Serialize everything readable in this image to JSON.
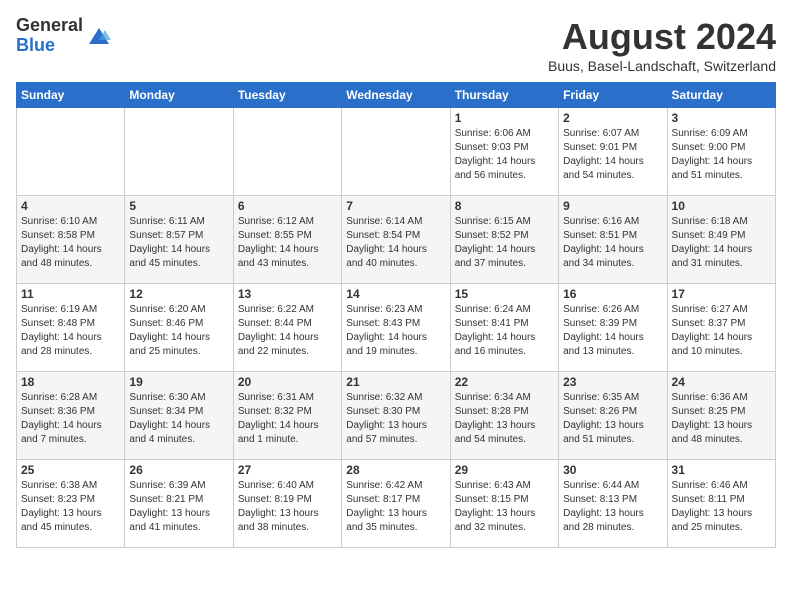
{
  "logo": {
    "general": "General",
    "blue": "Blue"
  },
  "header": {
    "month_year": "August 2024",
    "location": "Buus, Basel-Landschaft, Switzerland"
  },
  "weekdays": [
    "Sunday",
    "Monday",
    "Tuesday",
    "Wednesday",
    "Thursday",
    "Friday",
    "Saturday"
  ],
  "weeks": [
    [
      {
        "day": "",
        "info": ""
      },
      {
        "day": "",
        "info": ""
      },
      {
        "day": "",
        "info": ""
      },
      {
        "day": "",
        "info": ""
      },
      {
        "day": "1",
        "info": "Sunrise: 6:06 AM\nSunset: 9:03 PM\nDaylight: 14 hours\nand 56 minutes."
      },
      {
        "day": "2",
        "info": "Sunrise: 6:07 AM\nSunset: 9:01 PM\nDaylight: 14 hours\nand 54 minutes."
      },
      {
        "day": "3",
        "info": "Sunrise: 6:09 AM\nSunset: 9:00 PM\nDaylight: 14 hours\nand 51 minutes."
      }
    ],
    [
      {
        "day": "4",
        "info": "Sunrise: 6:10 AM\nSunset: 8:58 PM\nDaylight: 14 hours\nand 48 minutes."
      },
      {
        "day": "5",
        "info": "Sunrise: 6:11 AM\nSunset: 8:57 PM\nDaylight: 14 hours\nand 45 minutes."
      },
      {
        "day": "6",
        "info": "Sunrise: 6:12 AM\nSunset: 8:55 PM\nDaylight: 14 hours\nand 43 minutes."
      },
      {
        "day": "7",
        "info": "Sunrise: 6:14 AM\nSunset: 8:54 PM\nDaylight: 14 hours\nand 40 minutes."
      },
      {
        "day": "8",
        "info": "Sunrise: 6:15 AM\nSunset: 8:52 PM\nDaylight: 14 hours\nand 37 minutes."
      },
      {
        "day": "9",
        "info": "Sunrise: 6:16 AM\nSunset: 8:51 PM\nDaylight: 14 hours\nand 34 minutes."
      },
      {
        "day": "10",
        "info": "Sunrise: 6:18 AM\nSunset: 8:49 PM\nDaylight: 14 hours\nand 31 minutes."
      }
    ],
    [
      {
        "day": "11",
        "info": "Sunrise: 6:19 AM\nSunset: 8:48 PM\nDaylight: 14 hours\nand 28 minutes."
      },
      {
        "day": "12",
        "info": "Sunrise: 6:20 AM\nSunset: 8:46 PM\nDaylight: 14 hours\nand 25 minutes."
      },
      {
        "day": "13",
        "info": "Sunrise: 6:22 AM\nSunset: 8:44 PM\nDaylight: 14 hours\nand 22 minutes."
      },
      {
        "day": "14",
        "info": "Sunrise: 6:23 AM\nSunset: 8:43 PM\nDaylight: 14 hours\nand 19 minutes."
      },
      {
        "day": "15",
        "info": "Sunrise: 6:24 AM\nSunset: 8:41 PM\nDaylight: 14 hours\nand 16 minutes."
      },
      {
        "day": "16",
        "info": "Sunrise: 6:26 AM\nSunset: 8:39 PM\nDaylight: 14 hours\nand 13 minutes."
      },
      {
        "day": "17",
        "info": "Sunrise: 6:27 AM\nSunset: 8:37 PM\nDaylight: 14 hours\nand 10 minutes."
      }
    ],
    [
      {
        "day": "18",
        "info": "Sunrise: 6:28 AM\nSunset: 8:36 PM\nDaylight: 14 hours\nand 7 minutes."
      },
      {
        "day": "19",
        "info": "Sunrise: 6:30 AM\nSunset: 8:34 PM\nDaylight: 14 hours\nand 4 minutes."
      },
      {
        "day": "20",
        "info": "Sunrise: 6:31 AM\nSunset: 8:32 PM\nDaylight: 14 hours\nand 1 minute."
      },
      {
        "day": "21",
        "info": "Sunrise: 6:32 AM\nSunset: 8:30 PM\nDaylight: 13 hours\nand 57 minutes."
      },
      {
        "day": "22",
        "info": "Sunrise: 6:34 AM\nSunset: 8:28 PM\nDaylight: 13 hours\nand 54 minutes."
      },
      {
        "day": "23",
        "info": "Sunrise: 6:35 AM\nSunset: 8:26 PM\nDaylight: 13 hours\nand 51 minutes."
      },
      {
        "day": "24",
        "info": "Sunrise: 6:36 AM\nSunset: 8:25 PM\nDaylight: 13 hours\nand 48 minutes."
      }
    ],
    [
      {
        "day": "25",
        "info": "Sunrise: 6:38 AM\nSunset: 8:23 PM\nDaylight: 13 hours\nand 45 minutes."
      },
      {
        "day": "26",
        "info": "Sunrise: 6:39 AM\nSunset: 8:21 PM\nDaylight: 13 hours\nand 41 minutes."
      },
      {
        "day": "27",
        "info": "Sunrise: 6:40 AM\nSunset: 8:19 PM\nDaylight: 13 hours\nand 38 minutes."
      },
      {
        "day": "28",
        "info": "Sunrise: 6:42 AM\nSunset: 8:17 PM\nDaylight: 13 hours\nand 35 minutes."
      },
      {
        "day": "29",
        "info": "Sunrise: 6:43 AM\nSunset: 8:15 PM\nDaylight: 13 hours\nand 32 minutes."
      },
      {
        "day": "30",
        "info": "Sunrise: 6:44 AM\nSunset: 8:13 PM\nDaylight: 13 hours\nand 28 minutes."
      },
      {
        "day": "31",
        "info": "Sunrise: 6:46 AM\nSunset: 8:11 PM\nDaylight: 13 hours\nand 25 minutes."
      }
    ]
  ]
}
